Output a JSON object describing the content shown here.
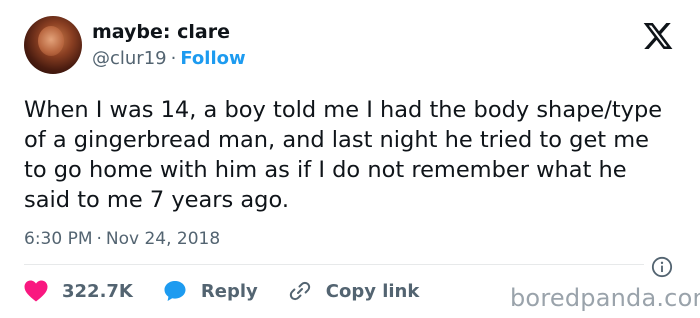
{
  "profile": {
    "display_name": "maybe: clare",
    "handle": "@clur19",
    "separator": "·",
    "follow_label": "Follow"
  },
  "tweet": {
    "text": "When I was 14, a boy told me I had the body shape/type of a gingerbread man, and last night he tried to get me to go home with him as if I do not remember what he said to me 7 years ago.",
    "time": "6:30 PM",
    "date": "Nov 24, 2018"
  },
  "actions": {
    "like_count": "322.7K",
    "reply_label": "Reply",
    "copy_link_label": "Copy link"
  },
  "watermark": {
    "text": "boredpanda.com"
  },
  "icons": {
    "platform": "x-logo-icon",
    "info": "info-icon",
    "like": "heart-icon",
    "reply": "speech-bubble-icon",
    "copy": "link-icon"
  },
  "colors": {
    "text": "#0f1419",
    "secondary": "#536471",
    "link": "#1d9bf0",
    "like": "#f91880",
    "watermark": "#9aa3ab"
  }
}
